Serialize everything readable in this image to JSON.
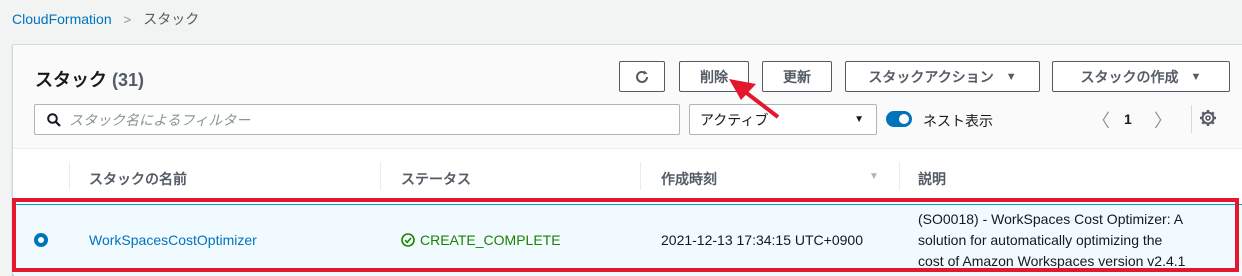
{
  "breadcrumb": {
    "root": "CloudFormation",
    "separator": ">",
    "current": "スタック"
  },
  "header": {
    "title": "スタック",
    "count": "(31)"
  },
  "toolbar": {
    "refresh_icon": "refresh-icon",
    "delete_label": "削除",
    "update_label": "更新",
    "actions_label": "スタックアクション",
    "create_label": "スタックの作成",
    "caret": "▼"
  },
  "filter": {
    "placeholder": "スタック名によるフィルター",
    "status_selected": "アクティブ",
    "select_caret": "▼",
    "nested_label": "ネスト表示",
    "nested_on": true
  },
  "pagination": {
    "prev": "〈",
    "page": "1",
    "next": "〉"
  },
  "table": {
    "headers": [
      "スタックの名前",
      "ステータス",
      "作成時刻",
      "説明"
    ],
    "sort_indicator": "▼",
    "rows": [
      {
        "selected": true,
        "name": "WorkSpacesCostOptimizer",
        "status": "CREATE_COMPLETE",
        "created": "2021-12-13 17:34:15 UTC+0900",
        "description": [
          "(SO0018) - WorkSpaces Cost Optimizer: A",
          "solution for automatically optimizing the",
          "cost of Amazon Workspaces version v2.4.1"
        ]
      }
    ]
  },
  "colors": {
    "link": "#0073bb",
    "success": "#1d8102",
    "annotation": "#e3172d"
  }
}
